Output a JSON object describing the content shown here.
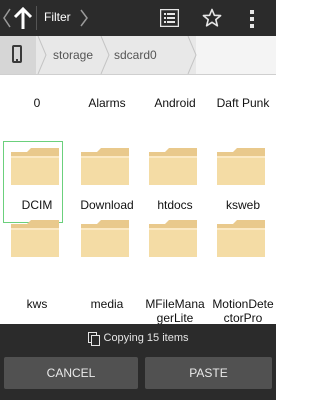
{
  "colors": {
    "actionbar": "#2b2b2b",
    "pathbar": "#e8e8e8",
    "folder": "#f2d9a0",
    "selection": "#6bd07c",
    "button": "#515151"
  },
  "actionbar": {
    "title": "Filter",
    "icons": [
      "chevron-left-icon",
      "up-arrow-icon",
      "chevron-right-icon",
      "list-view-icon",
      "star-icon",
      "overflow-menu-icon"
    ]
  },
  "breadcrumb": {
    "device_icon": "phone-icon",
    "items": [
      "storage",
      "sdcard0"
    ]
  },
  "folders": [
    {
      "name": "0"
    },
    {
      "name": "Alarms"
    },
    {
      "name": "Android"
    },
    {
      "name": "Daft Punk"
    },
    {
      "name": "DCIM",
      "selected": true
    },
    {
      "name": "Download"
    },
    {
      "name": "htdocs"
    },
    {
      "name": "ksweb"
    },
    {
      "name": "kws"
    },
    {
      "name": "media"
    },
    {
      "name": "MFileManagerLite"
    },
    {
      "name": "MotionDetectorPro"
    }
  ],
  "bottom": {
    "status": "Copying 15 items",
    "cancel_label": "CANCEL",
    "paste_label": "PASTE"
  }
}
